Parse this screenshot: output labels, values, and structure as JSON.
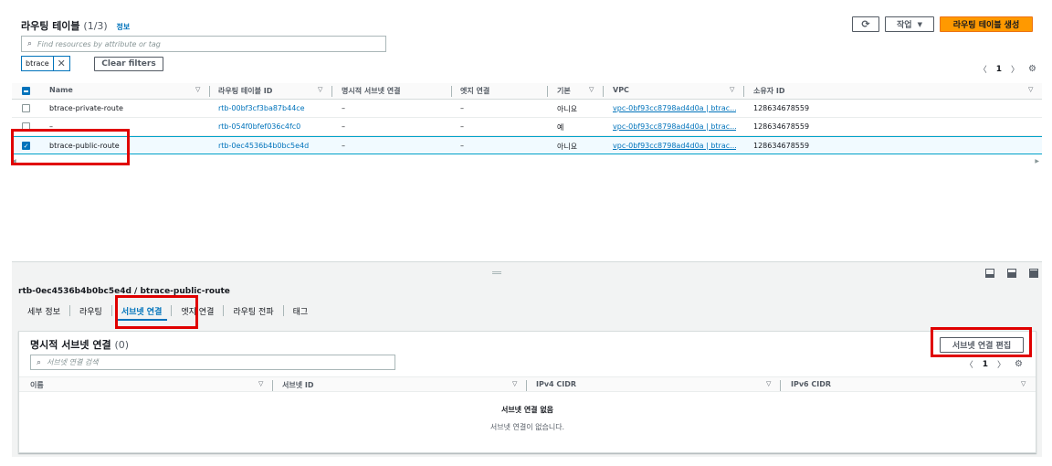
{
  "top": {
    "title": "라우팅 테이블",
    "count": "(1/3)",
    "info_link": "정보",
    "refresh_icon": "refresh-icon",
    "actions_label": "작업",
    "create_label": "라우팅 테이블 생성",
    "search_placeholder": "Find resources by attribute or tag",
    "filter_token": "btrace",
    "clear_filters": "Clear filters",
    "page": "1"
  },
  "columns": [
    "Name",
    "라우팅 테이블 ID",
    "명시적 서브넷 연결",
    "엣지 연결",
    "기본",
    "VPC",
    "소유자 ID"
  ],
  "rows": [
    {
      "name": "btrace-private-route",
      "id": "rtb-00bf3cf3ba87b44ce",
      "subnet": "–",
      "edge": "–",
      "main": "아니요",
      "vpc": "vpc-0bf93cc8798ad4d0a | btrac...",
      "owner": "128634678559",
      "checked": false
    },
    {
      "name": "–",
      "id": "rtb-054f0bfef036c4fc0",
      "subnet": "–",
      "edge": "–",
      "main": "예",
      "vpc": "vpc-0bf93cc8798ad4d0a | btrac...",
      "owner": "128634678559",
      "checked": false
    },
    {
      "name": "btrace-public-route",
      "id": "rtb-0ec4536b4b0bc5e4d",
      "subnet": "–",
      "edge": "–",
      "main": "아니요",
      "vpc": "vpc-0bf93cc8798ad4d0a | btrac...",
      "owner": "128634678559",
      "checked": true
    }
  ],
  "detail": {
    "title": "rtb-0ec4536b4b0bc5e4d / btrace-public-route",
    "tabs": [
      "세부 정보",
      "라우팅",
      "서브넷 연결",
      "엣지 연결",
      "라우팅 전파",
      "태그"
    ],
    "active_tab": 2,
    "card_title": "명시적 서브넷 연결",
    "card_count": "(0)",
    "edit_button": "서브넷 연결 편집",
    "search_placeholder": "서브넷 연결 검색",
    "page": "1",
    "columns": [
      "이름",
      "서브넷 ID",
      "IPv4 CIDR",
      "IPv6 CIDR"
    ],
    "empty_title": "서브넷 연결 없음",
    "empty_sub": "서브넷 연결이 없습니다."
  },
  "colors": {
    "primary": "#ff9900",
    "link": "#0073bb",
    "highlight": "#e00000"
  }
}
